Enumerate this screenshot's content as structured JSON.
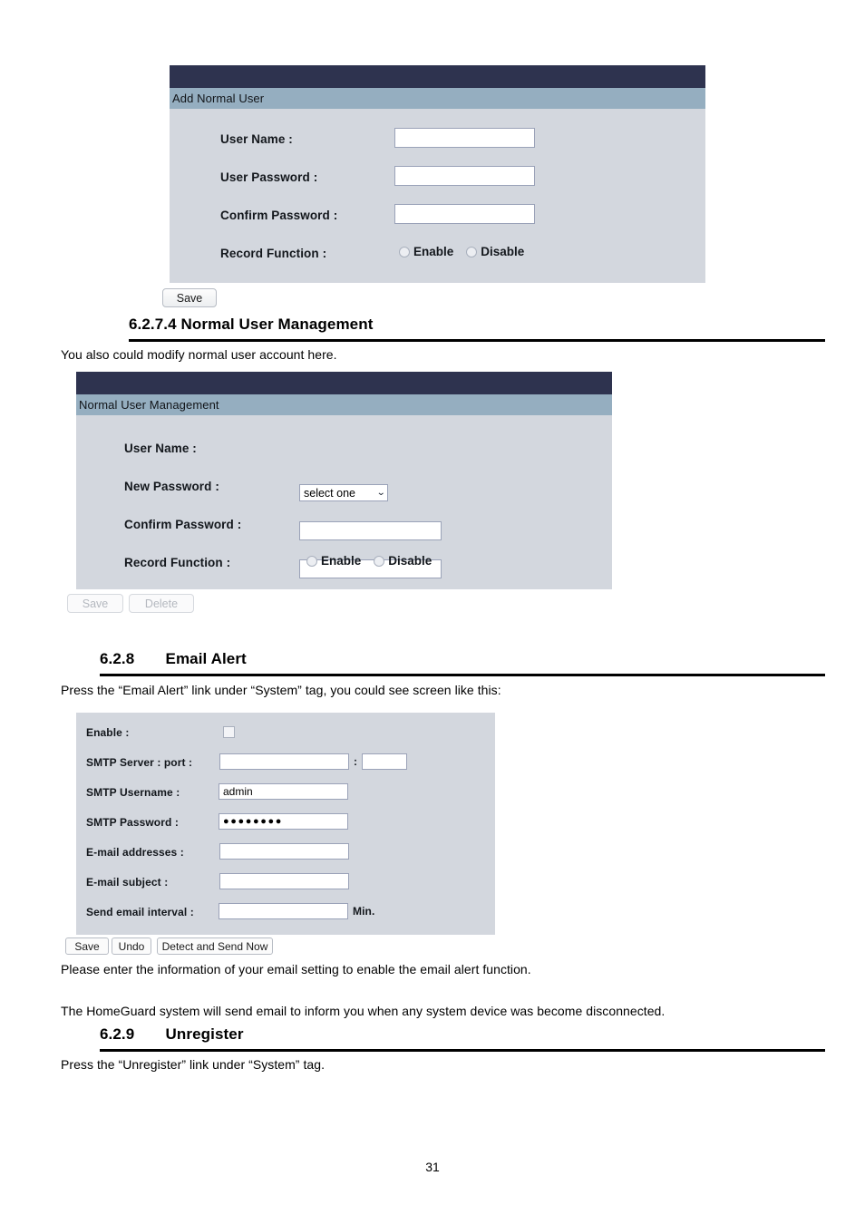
{
  "document": {
    "page_number": "31",
    "sections": [
      {
        "number": "6.2.7.4",
        "gap": " ",
        "title": "Normal User Management"
      },
      {
        "number": "6.2.8",
        "gap": "  ",
        "title": "Email Alert"
      },
      {
        "number": "6.2.9",
        "gap": "  ",
        "title": "Unregister"
      }
    ],
    "paragraphs": {
      "normal_user_intro": "You also could modify normal user account here.",
      "email_alert_intro": "Press the “Email Alert” link under “System” tag, you could see screen like this:",
      "email_alert_note1": "Please enter the information of your email setting to enable the email alert function.",
      "email_alert_note2": "The HomeGuard system will send email to inform you when any system device was become disconnected.",
      "unregister_intro": "Press the “Unregister” link under “System” tag."
    }
  },
  "colors": {
    "panel_topbar": "#2e334f",
    "panel_titlebar": "#95aec0",
    "panel_body": "#d3d7de",
    "field_border": "#9aa2b8"
  },
  "add_normal_user_panel": {
    "title": "Add Normal User",
    "fields": {
      "user_name_label": "User Name :",
      "user_name_value": "",
      "user_password_label": "User Password :",
      "user_password_value": "",
      "confirm_password_label": "Confirm Password :",
      "confirm_password_value": "",
      "record_function_label": "Record Function :",
      "record_enable_label": "Enable",
      "record_disable_label": "Disable",
      "record_selected": ""
    },
    "buttons": {
      "save_label": "Save"
    }
  },
  "normal_user_management_panel": {
    "title": "Normal User Management",
    "fields": {
      "user_name_label": "User Name :",
      "user_name_selected": "select one",
      "user_name_caret": "⌄",
      "new_password_label": "New Password :",
      "new_password_value": "",
      "confirm_password_label": "Confirm Password :",
      "confirm_password_value": "",
      "record_function_label": "Record Function :",
      "record_enable_label": "Enable",
      "record_disable_label": "Disable",
      "record_selected": ""
    },
    "buttons": {
      "save_label": "Save",
      "delete_label": "Delete"
    }
  },
  "email_alert_panel": {
    "fields": {
      "enable_label": "Enable :",
      "enable_checked": false,
      "smtp_server_label": "SMTP Server : port :",
      "smtp_server_value": "",
      "smtp_port_separator": ":",
      "smtp_port_value": "",
      "smtp_username_label": "SMTP Username :",
      "smtp_username_value": "admin",
      "smtp_password_label": "SMTP Password :",
      "smtp_password_value": "●●●●●●●●",
      "email_addresses_label": "E-mail addresses :",
      "email_addresses_value": "",
      "email_subject_label": "E-mail subject :",
      "email_subject_value": "",
      "send_email_interval_label": "Send email interval :",
      "send_email_interval_value": "",
      "send_email_interval_unit": "Min."
    },
    "buttons": {
      "save_label": "Save",
      "undo_label": "Undo",
      "detect_send_label": "Detect and Send Now"
    }
  }
}
